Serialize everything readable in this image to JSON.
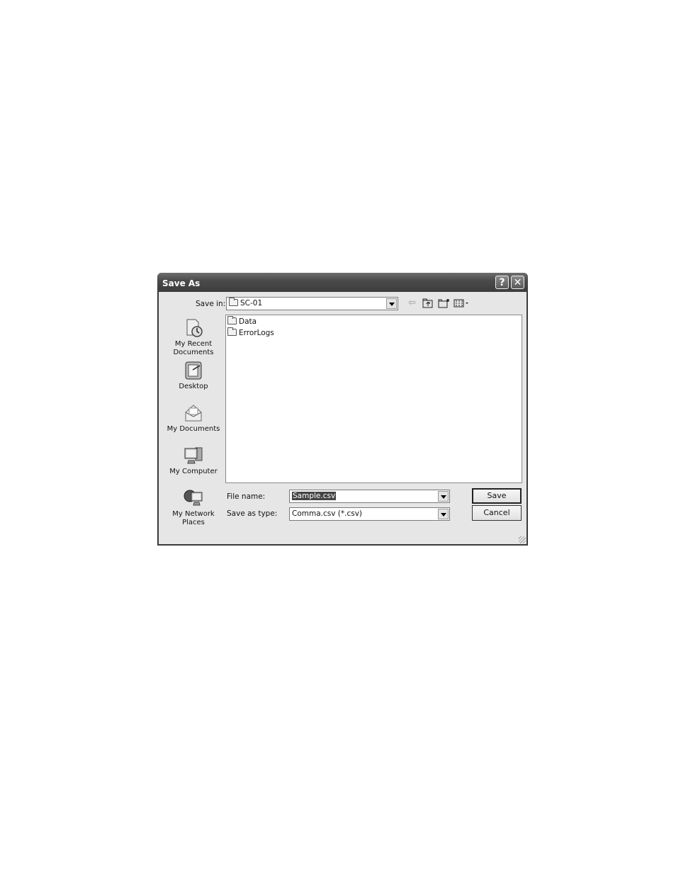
{
  "dialog": {
    "title": "Save As",
    "help_icon": "help-icon",
    "close_icon": "close-icon"
  },
  "save_in": {
    "label": "Save in:",
    "value": "SC-01",
    "value_icon": "folder-icon"
  },
  "toolbar": {
    "back_icon": "back-arrow-icon",
    "up_icon": "up-one-level-icon",
    "new_folder_icon": "new-folder-icon",
    "views_icon": "views-menu-icon"
  },
  "places": [
    {
      "label_line1": "My Recent",
      "label_line2": "Documents",
      "icon": "recent-documents-icon"
    },
    {
      "label_line1": "Desktop",
      "label_line2": "",
      "icon": "desktop-icon"
    },
    {
      "label_line1": "My Documents",
      "label_line2": "",
      "icon": "my-documents-icon"
    },
    {
      "label_line1": "My Computer",
      "label_line2": "",
      "icon": "my-computer-icon"
    },
    {
      "label_line1": "My Network",
      "label_line2": "Places",
      "icon": "network-places-icon"
    }
  ],
  "files": [
    {
      "name": "Data",
      "icon": "folder-icon"
    },
    {
      "name": "ErrorLogs",
      "icon": "folder-icon"
    }
  ],
  "file_name": {
    "label": "File name:",
    "value": "Sample.csv"
  },
  "save_as_type": {
    "label": "Save as type:",
    "value": "Comma.csv (*.csv)"
  },
  "buttons": {
    "save": "Save",
    "cancel": "Cancel"
  }
}
